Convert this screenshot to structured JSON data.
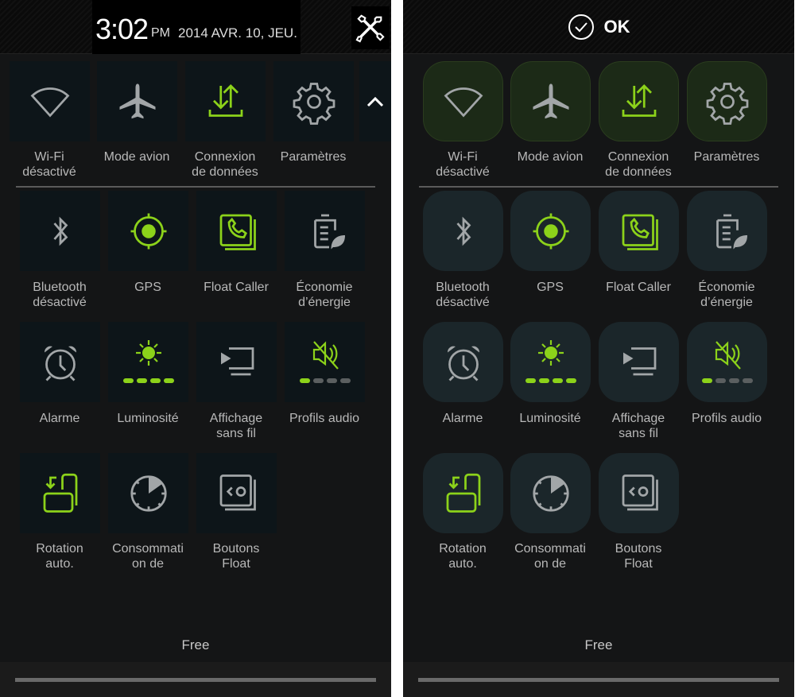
{
  "colors": {
    "accent": "#8cd21a",
    "inactive": "#a2a6a8",
    "label": "#b8b8b8"
  },
  "left_panel": {
    "header": {
      "time": "3:02",
      "ampm": "PM",
      "date": "2014 AVR. 10, JEU.",
      "settings_icon": "tools-icon"
    },
    "expand_icon": "chevron-up-icon",
    "footer": {
      "carrier": "Free"
    }
  },
  "right_panel": {
    "header": {
      "ok_label": "OK",
      "ok_icon": "check-circle-icon"
    },
    "footer": {
      "carrier": "Free"
    }
  },
  "tiles": [
    {
      "id": "wifi",
      "icon": "wifi-icon",
      "label": [
        "Wi-Fi",
        "désactivé"
      ],
      "active": false
    },
    {
      "id": "airplane",
      "icon": "airplane-icon",
      "label": [
        "Mode avion"
      ],
      "active": false
    },
    {
      "id": "data",
      "icon": "data-transfer-icon",
      "label": [
        "Connexion",
        "de données"
      ],
      "active": true
    },
    {
      "id": "settings",
      "icon": "gear-icon",
      "label": [
        "Paramètres"
      ],
      "active": false
    },
    {
      "id": "bluetooth",
      "icon": "bluetooth-icon",
      "label": [
        "Bluetooth",
        "désactivé"
      ],
      "active": false
    },
    {
      "id": "gps",
      "icon": "gps-icon",
      "label": [
        "GPS"
      ],
      "active": true
    },
    {
      "id": "float-caller",
      "icon": "phone-icon",
      "label": [
        "Float Caller"
      ],
      "active": true
    },
    {
      "id": "power-saving",
      "icon": "battery-leaf-icon",
      "label": [
        "Économie",
        "d’énergie"
      ],
      "active": false
    },
    {
      "id": "alarm",
      "icon": "alarm-icon",
      "label": [
        "Alarme"
      ],
      "active": false
    },
    {
      "id": "brightness",
      "icon": "sun-icon",
      "label": [
        "Luminosité"
      ],
      "active": true,
      "level": 4,
      "level_max": 4
    },
    {
      "id": "screen-mirroring",
      "icon": "cast-icon",
      "label": [
        "Affichage",
        "sans fil"
      ],
      "active": false
    },
    {
      "id": "sound-profile",
      "icon": "mute-icon",
      "label": [
        "Profils audio"
      ],
      "active": true,
      "level": 1,
      "level_max": 4
    },
    {
      "id": "rotation",
      "icon": "rotate-icon",
      "label": [
        "Rotation",
        "auto."
      ],
      "active": true
    },
    {
      "id": "power-usage",
      "icon": "timer-icon",
      "label": [
        "Consommati",
        "on de"
      ],
      "active": false
    },
    {
      "id": "float-buttons",
      "icon": "float-buttons-icon",
      "label": [
        "Boutons",
        "Float"
      ],
      "active": false
    }
  ]
}
